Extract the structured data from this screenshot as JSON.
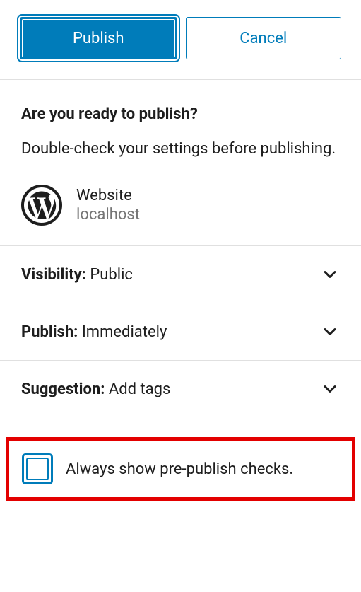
{
  "buttons": {
    "publish": "Publish",
    "cancel": "Cancel"
  },
  "intro": {
    "heading": "Are you ready to publish?",
    "subtext": "Double-check your settings before publishing."
  },
  "site": {
    "name": "Website",
    "host": "localhost"
  },
  "panels": {
    "visibility": {
      "label": "Visibility:",
      "value": "Public"
    },
    "publish": {
      "label": "Publish:",
      "value": "Immediately"
    },
    "suggestion": {
      "label": "Suggestion:",
      "value": "Add tags"
    }
  },
  "checkbox": {
    "label": "Always show pre-publish checks."
  }
}
